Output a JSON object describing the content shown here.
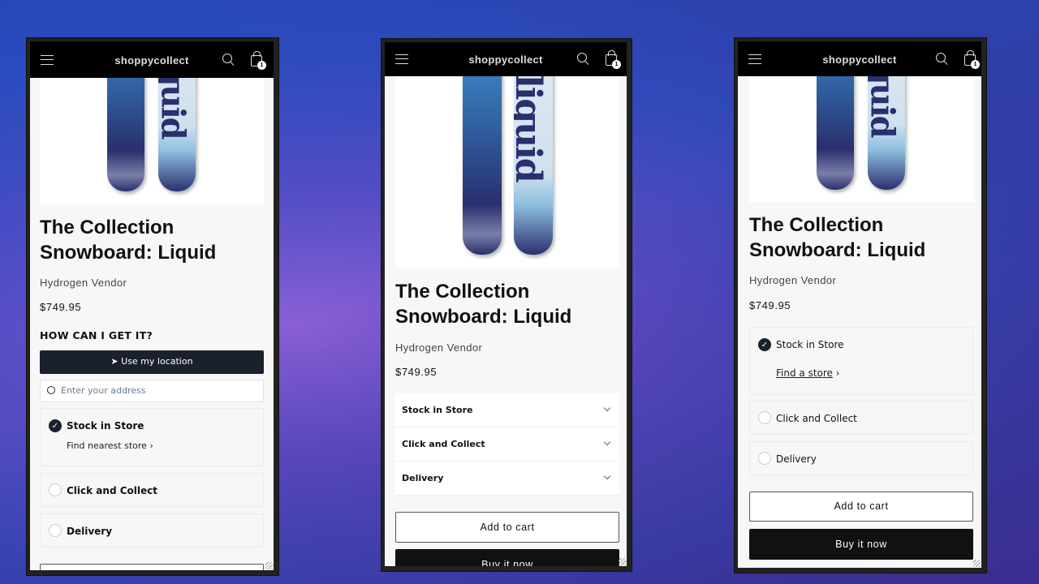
{
  "brand": "shoppycollect",
  "cart_count": "1",
  "board_text": "liquid",
  "product": {
    "title": "The Collection Snowboard: Liquid",
    "vendor": "Hydrogen Vendor",
    "price": "$749.95"
  },
  "colors": {
    "header": "#000000",
    "primary_button": "#1a202c",
    "buy_button": "#111111"
  },
  "phone1": {
    "heading": "HOW CAN I GET IT?",
    "use_location": "Use my location",
    "address_placeholder": "Enter your address",
    "options": [
      {
        "label": "Stock in Store",
        "link": "Find nearest store",
        "selected": true
      },
      {
        "label": "Click and Collect",
        "selected": false
      },
      {
        "label": "Delivery",
        "selected": false
      }
    ]
  },
  "phone2": {
    "accordion": [
      "Stock in Store",
      "Click and Collect",
      "Delivery"
    ],
    "add_to_cart": "Add to cart",
    "buy_now": "Buy it now"
  },
  "phone3": {
    "options": [
      {
        "label": "Stock in Store",
        "link": "Find a store",
        "selected": true
      },
      {
        "label": "Click and Collect",
        "selected": false
      },
      {
        "label": "Delivery",
        "selected": false
      }
    ],
    "add_to_cart": "Add to cart",
    "buy_now": "Buy it now"
  }
}
